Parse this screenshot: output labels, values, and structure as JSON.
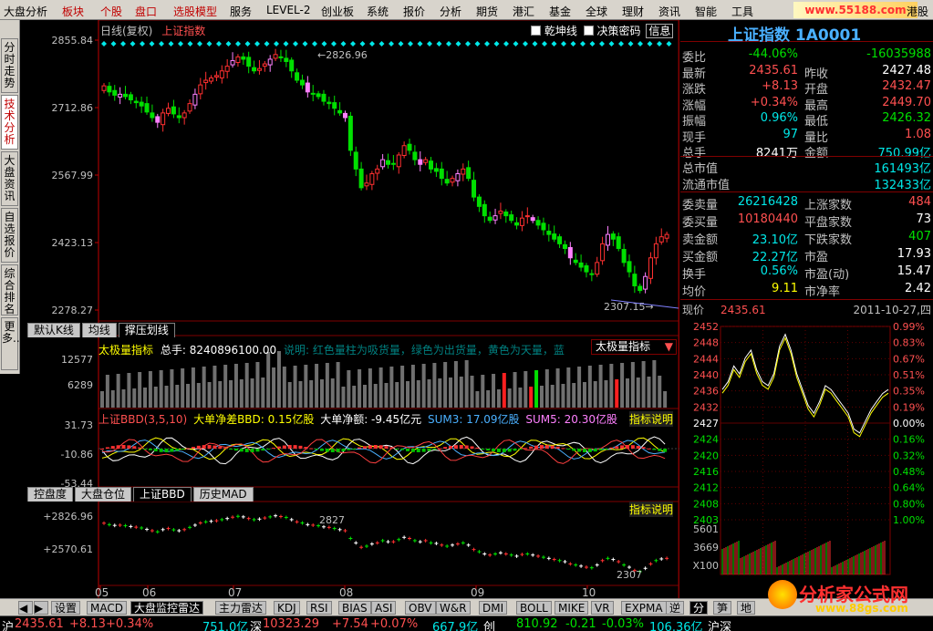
{
  "menu": {
    "items": [
      "大盘分析",
      "板块",
      "个股",
      "盘口",
      "选股模型",
      "服务",
      "LEVEL-2",
      "创业板",
      "系统",
      "报价",
      "分析",
      "期货",
      "港汇",
      "基金",
      "全球",
      "理财",
      "资讯",
      "智能",
      "工具"
    ],
    "red_items": [
      "板块",
      "个股",
      "盘口",
      "选股模型"
    ],
    "right_text": "港股",
    "logo_text": "www.55188.com"
  },
  "side_tabs": [
    "分时走势",
    "技术分析",
    "大盘资讯",
    "自选报价",
    "综合排名",
    "更多..."
  ],
  "side_active": "技术分析",
  "kline": {
    "title_period": "日线(复权)",
    "title_name": "上证指数",
    "checkbox_qiankun": "乾坤线",
    "checkbox_juece": "决策密码",
    "info_button": "信息",
    "y_labels": [
      "2855.84",
      "2712.86",
      "2567.99",
      "2423.13",
      "2278.27"
    ],
    "high_marker": "2826.96",
    "low_marker": "2307.15"
  },
  "kline_tabs": [
    "默认K线",
    "均线",
    "撑压划线"
  ],
  "kline_tab_active": "撑压划线",
  "volume": {
    "label_name": "太极量指标",
    "label_total": "总手: 8240896100.00",
    "label_desc": "说明: 红色量柱为吸货量，绿色为出货量，黄色为天量，蓝",
    "dropdown": "太极量指标",
    "y_labels": [
      "12577",
      "6289"
    ]
  },
  "bbd": {
    "label_name": "上证BBD(3,5,10)",
    "label_net": "大单净差BBD: 0.15亿股",
    "label_amount": "大单净额: -9.45亿元",
    "label_sum3": "SUM3: 17.09亿股",
    "label_sum5": "SUM5: 20.30亿股",
    "explain": "指标说明",
    "y_labels": [
      "31.73",
      "-10.86",
      "-53.44"
    ]
  },
  "sub_tabs": [
    "控盘度",
    "大盘仓位",
    "上证BBD",
    "历史MAD"
  ],
  "sub_tab_active": "上证BBD",
  "bottom_chart": {
    "explain": "指标说明",
    "y_labels": [
      "+2826.96",
      "+2570.61"
    ],
    "high_marker": "2827",
    "low_marker": "2307"
  },
  "x_axis_months": [
    "05",
    "06",
    "07",
    "08",
    "09",
    "10"
  ],
  "quote": {
    "title": "上证指数 1A0001",
    "rows": [
      {
        "l1": "委比",
        "v1": "-44.06%",
        "c1": "#00e000",
        "l2": "",
        "v2": "-16035988",
        "c2": "#00e000"
      },
      {
        "l1": "最新",
        "v1": "2435.61",
        "c1": "#ff5050",
        "l2": "昨收",
        "v2": "2427.48",
        "c2": "#ffffff"
      },
      {
        "l1": "涨跌",
        "v1": "+8.13",
        "c1": "#ff5050",
        "l2": "开盘",
        "v2": "2432.47",
        "c2": "#ff5050"
      },
      {
        "l1": "涨幅",
        "v1": "+0.34%",
        "c1": "#ff5050",
        "l2": "最高",
        "v2": "2449.70",
        "c2": "#ff5050"
      },
      {
        "l1": "振幅",
        "v1": "0.96%",
        "c1": "#00e8e8",
        "l2": "最低",
        "v2": "2426.32",
        "c2": "#00e000"
      },
      {
        "l1": "现手",
        "v1": "97",
        "c1": "#00e8e8",
        "l2": "量比",
        "v2": "1.08",
        "c2": "#ff5050"
      },
      {
        "l1": "总手",
        "v1": "8241万",
        "c1": "#ffffff",
        "l2": "金额",
        "v2": "750.99亿",
        "c2": "#00e8e8"
      }
    ],
    "cap_rows": [
      {
        "l": "总市值",
        "v": "161493亿",
        "c": "#00e8e8"
      },
      {
        "l": "流通市值",
        "v": "132433亿",
        "c": "#00e8e8"
      }
    ],
    "rows2": [
      {
        "l1": "委卖量",
        "v1": "26216428",
        "c1": "#00e8e8",
        "l2": "上涨家数",
        "v2": "484",
        "c2": "#ff5050"
      },
      {
        "l1": "委买量",
        "v1": "10180440",
        "c1": "#ff5050",
        "l2": "平盘家数",
        "v2": "73",
        "c2": "#ffffff"
      },
      {
        "l1": "卖金额",
        "v1": "23.10亿",
        "c1": "#00e8e8",
        "l2": "下跌家数",
        "v2": "407",
        "c2": "#00e000"
      },
      {
        "l1": "买金额",
        "v1": "22.27亿",
        "c1": "#00e8e8",
        "l2": "市盈",
        "v2": "17.93",
        "c2": "#ffffff"
      },
      {
        "l1": "换手",
        "v1": "0.56%",
        "c1": "#00e8e8",
        "l2": "市盈(动)",
        "v2": "15.47",
        "c2": "#ffffff"
      },
      {
        "l1": "均价",
        "v1": "9.11",
        "c1": "#ffff00",
        "l2": "市净率",
        "v2": "2.42",
        "c2": "#ffffff"
      }
    ]
  },
  "intraday": {
    "price_label": "现价",
    "price_value": "2435.61",
    "date": "2011-10-27,四",
    "left_labels": [
      "2452",
      "2448",
      "2444",
      "2440",
      "2436",
      "2432",
      "2427",
      "2424",
      "2420",
      "2416",
      "2412",
      "2408",
      "2403"
    ],
    "right_labels": [
      "0.99%",
      "0.83%",
      "0.67%",
      "0.51%",
      "0.35%",
      "0.19%",
      "0.00%",
      "0.16%",
      "0.32%",
      "0.48%",
      "0.64%",
      "0.80%",
      "1.00%"
    ],
    "vol_labels": [
      "5601",
      "3669",
      "X100"
    ]
  },
  "bottom_tabs": [
    "设置",
    "MACD",
    "大盘监控雷达",
    "主力雷达",
    "KDJ",
    "RSI",
    "BIAS",
    "ASI",
    "OBV",
    "W&R",
    "DMI",
    "BOLL",
    "MIKE",
    "VR",
    "EXPMA",
    "逆"
  ],
  "bottom_tab_active": "大盘监控雷达",
  "right_bottom_tabs": [
    "分",
    "笋",
    "地"
  ],
  "watermark": "分析家公式网",
  "watermark_url": "www.88gs.com",
  "status": {
    "sh_label": "沪",
    "sh_price": "2435.61",
    "sh_change": "+8.13",
    "sh_pct": "+0.34%",
    "sh_amount": "751.0亿",
    "sz_label": "深",
    "sz_price": "10323.29",
    "sz_change": "+7.54",
    "sz_pct": "+0.07%",
    "sz_amount": "667.9亿",
    "cy_label": "创",
    "cy_price": "810.92",
    "cy_change": "-0.21",
    "cy_pct": "-0.03%",
    "cy_amount": "106.36亿",
    "hs_label": "沪深"
  }
}
